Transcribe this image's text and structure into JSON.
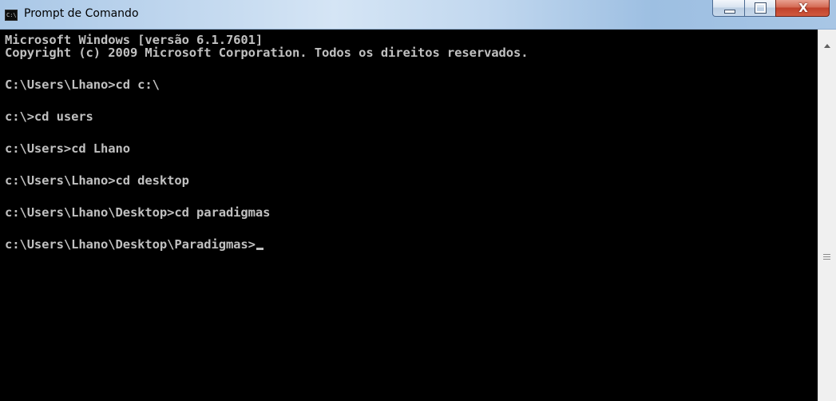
{
  "window": {
    "title": "Prompt de Comando",
    "icon_label": "C:\\",
    "controls": {
      "minimize": "minimize-icon",
      "maximize": "maximize-icon",
      "close_label": "X"
    }
  },
  "console": {
    "lines": [
      "Microsoft Windows [versão 6.1.7601]",
      "Copyright (c) 2009 Microsoft Corporation. Todos os direitos reservados.",
      "C:\\Users\\Lhano>cd c:\\",
      "c:\\>cd users",
      "c:\\Users>cd Lhano",
      "c:\\Users\\Lhano>cd desktop",
      "c:\\Users\\Lhano\\Desktop>cd paradigmas",
      "c:\\Users\\Lhano\\Desktop\\Paradigmas>"
    ],
    "colors": {
      "background": "#000000",
      "text": "#c0c0c0"
    }
  }
}
